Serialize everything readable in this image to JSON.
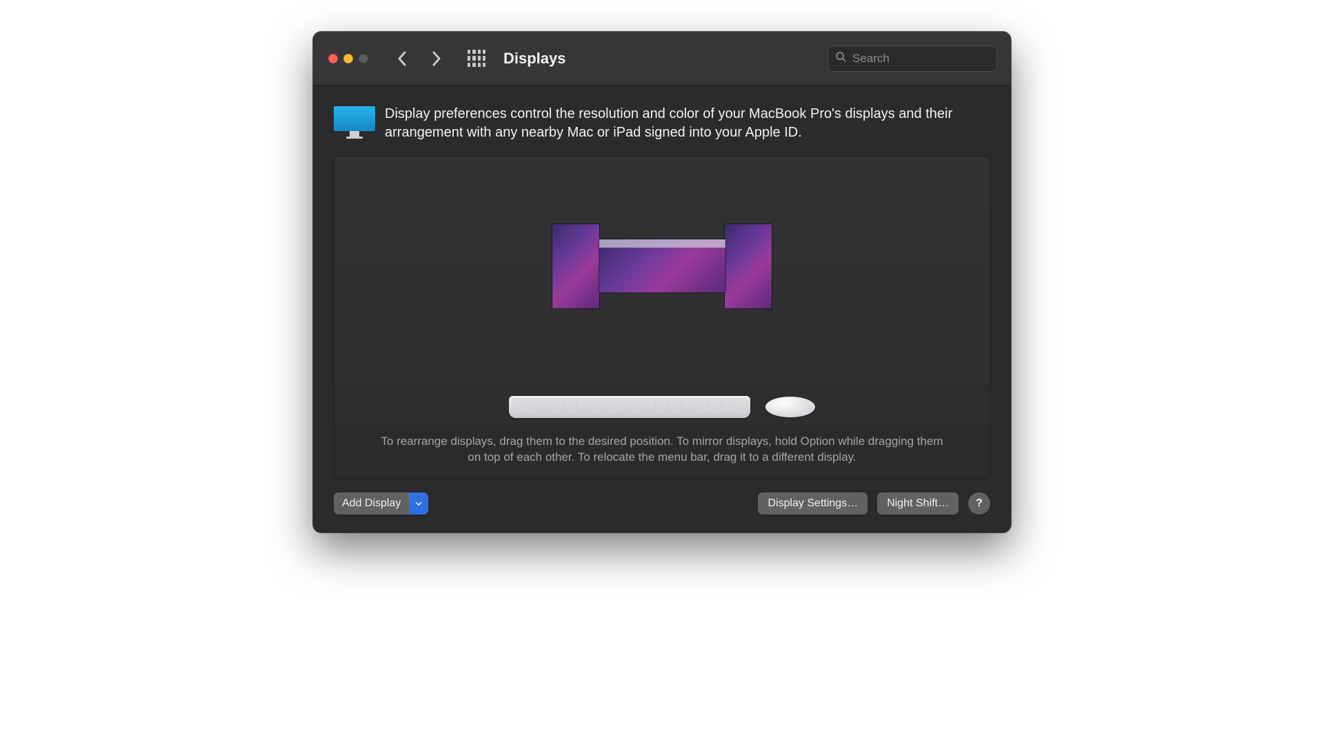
{
  "window": {
    "title": "Displays"
  },
  "search": {
    "placeholder": "Search",
    "value": ""
  },
  "description": "Display preferences control the resolution and color of your MacBook Pro's displays and their arrangement with any nearby Mac or iPad signed into your Apple ID.",
  "hint": "To rearrange displays, drag them to the desired position. To mirror displays, hold Option while dragging them on top of each other. To relocate the menu bar, drag it to a different display.",
  "buttons": {
    "add_display": "Add Display",
    "display_settings": "Display Settings…",
    "night_shift": "Night Shift…",
    "help": "?"
  }
}
